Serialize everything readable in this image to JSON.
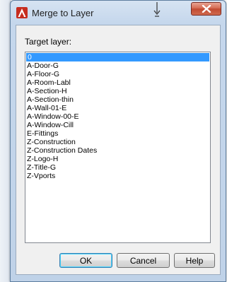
{
  "window": {
    "title": "Merge to Layer",
    "app_icon": "autocad-icon",
    "close_icon": "close-icon",
    "accent_color": "#c94a30"
  },
  "dialog": {
    "target_label": "Target layer:",
    "layers": [
      {
        "name": "0",
        "selected": true
      },
      {
        "name": "A-Door-G",
        "selected": false
      },
      {
        "name": "A-Floor-G",
        "selected": false
      },
      {
        "name": "A-Room-Labl",
        "selected": false
      },
      {
        "name": "A-Section-H",
        "selected": false
      },
      {
        "name": "A-Section-thin",
        "selected": false
      },
      {
        "name": "A-Wall-01-E",
        "selected": false
      },
      {
        "name": "A-Window-00-E",
        "selected": false
      },
      {
        "name": "A-Window-Cill",
        "selected": false
      },
      {
        "name": "E-Fittings",
        "selected": false
      },
      {
        "name": "Z-Construction",
        "selected": false
      },
      {
        "name": "Z-Construction Dates",
        "selected": false
      },
      {
        "name": "Z-Logo-H",
        "selected": false
      },
      {
        "name": "Z-Title-G",
        "selected": false
      },
      {
        "name": "Z-Vports",
        "selected": false
      }
    ],
    "selection_color": "#3399ff"
  },
  "buttons": {
    "ok": "OK",
    "cancel": "Cancel",
    "help": "Help"
  }
}
